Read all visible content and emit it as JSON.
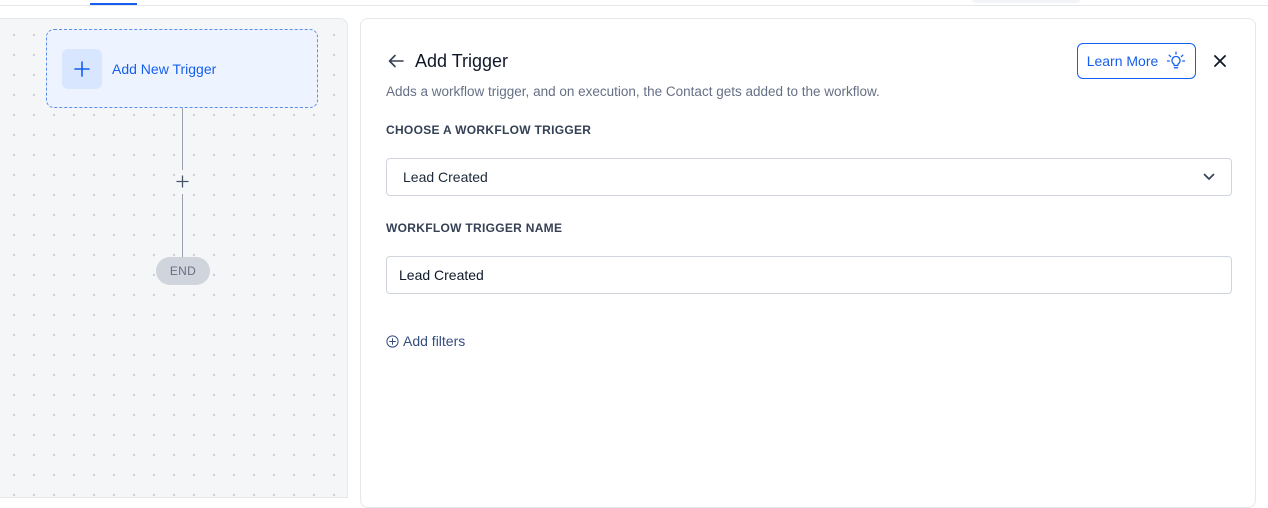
{
  "canvas": {
    "trigger_card_label": "Add New Trigger",
    "end_label": "END"
  },
  "panel": {
    "title": "Add Trigger",
    "description": "Adds a workflow trigger, and on execution, the Contact gets added to the workflow.",
    "learn_more_label": "Learn More",
    "trigger_select": {
      "label": "CHOOSE A WORKFLOW TRIGGER",
      "selected": "Lead Created"
    },
    "trigger_name": {
      "label": "WORKFLOW TRIGGER NAME",
      "value": "Lead Created"
    },
    "add_filters_label": "Add filters"
  },
  "colors": {
    "accent": "#155eef",
    "canvas_bg": "#f5f6f8",
    "card_bg": "#eef4ff"
  }
}
